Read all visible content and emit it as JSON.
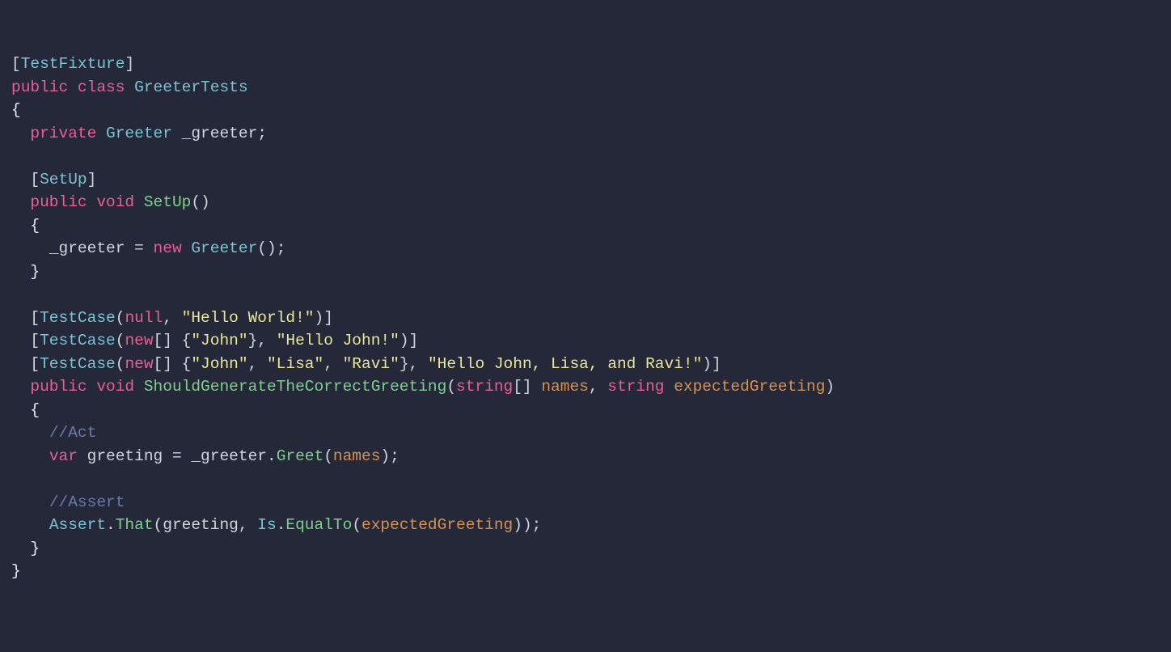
{
  "code": {
    "attr_testfixture": "TestFixture",
    "kw_public": "public",
    "kw_class": "class",
    "class_name": "GreeterTests",
    "brace_open": "{",
    "brace_close": "}",
    "kw_private": "private",
    "type_greeter": "Greeter",
    "field_greeter": "_greeter",
    "semi": ";",
    "attr_setup": "SetUp",
    "kw_void": "void",
    "method_setup": "SetUp",
    "parens": "()",
    "assign_eq": " = ",
    "kw_new": "new",
    "attr_testcase": "TestCase",
    "kw_null": "null",
    "comma_sp": ", ",
    "str_hello_world": "\"Hello World!\"",
    "arr_open": "[] {",
    "arr_close": "}",
    "str_john": "\"John\"",
    "str_hello_john": "\"Hello John!\"",
    "str_lisa": "\"Lisa\"",
    "str_ravi": "\"Ravi\"",
    "str_hello_all": "\"Hello John, Lisa, and Ravi!\"",
    "method_should": "ShouldGenerateTheCorrectGreeting",
    "kw_string": "string",
    "brackets": "[]",
    "param_names": "names",
    "param_expected": "expectedGreeting",
    "cmt_act": "//Act",
    "kw_var": "var",
    "id_greeting": "greeting",
    "method_greet": "Greet",
    "cmt_assert": "//Assert",
    "type_assert": "Assert",
    "method_that": "That",
    "type_is": "Is",
    "method_equalto": "EqualTo",
    "lparen": "(",
    "rparen": ")",
    "lbrack": "[",
    "rbrack": "]",
    "dot": "."
  }
}
